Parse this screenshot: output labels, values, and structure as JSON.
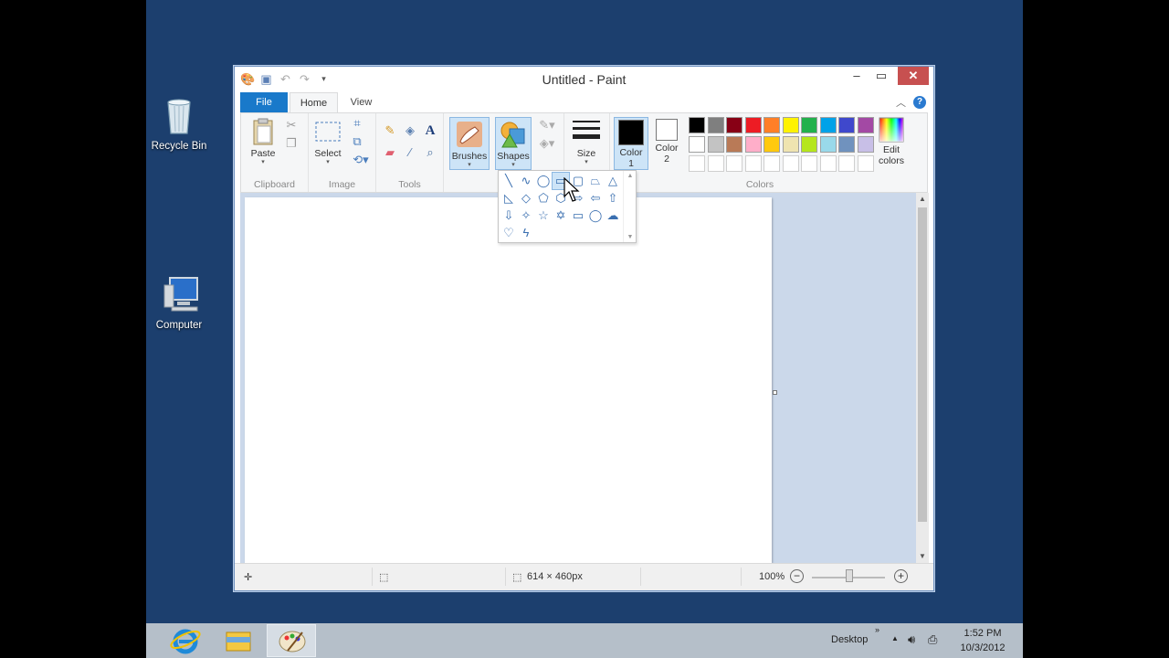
{
  "desktop": {
    "icons": [
      {
        "label": "Recycle Bin"
      },
      {
        "label": "Computer"
      }
    ]
  },
  "window": {
    "title": "Untitled - Paint",
    "tabs": {
      "file": "File",
      "home": "Home",
      "view": "View"
    }
  },
  "ribbon": {
    "clipboard": {
      "paste": "Paste",
      "label": "Clipboard"
    },
    "image": {
      "select": "Select",
      "label": "Image"
    },
    "tools": {
      "label": "Tools"
    },
    "brushes": {
      "label": "Brushes"
    },
    "shapes": {
      "label": "Shapes"
    },
    "size": {
      "label": "Size"
    },
    "color1": {
      "label_top": "Color",
      "label_bottom": "1"
    },
    "color2": {
      "label_top": "Color",
      "label_bottom": "2"
    },
    "edit_colors": {
      "label_top": "Edit",
      "label_bottom": "colors"
    },
    "colors_label": "Colors",
    "palette": {
      "row1": [
        "#000000",
        "#7f7f7f",
        "#880015",
        "#ed1c24",
        "#ff7f27",
        "#fff200",
        "#22b14c",
        "#00a2e8",
        "#3f48cc",
        "#a349a4"
      ],
      "row2": [
        "#ffffff",
        "#c3c3c3",
        "#b97a57",
        "#ffaec9",
        "#ffc90e",
        "#efe4b0",
        "#b5e61d",
        "#99d9ea",
        "#7092be",
        "#c8bfe7"
      ],
      "row3": [
        "#ffffff",
        "#ffffff",
        "#ffffff",
        "#ffffff",
        "#ffffff",
        "#ffffff",
        "#ffffff",
        "#ffffff",
        "#ffffff",
        "#ffffff"
      ]
    },
    "color1_value": "#000000",
    "color2_value": "#ffffff"
  },
  "shapes_popup": {
    "items": [
      "line",
      "curve",
      "oval",
      "rectangle",
      "rounded-rectangle",
      "polygon",
      "triangle",
      "right-triangle",
      "diamond",
      "pentagon",
      "hexagon",
      "right-arrow",
      "left-arrow",
      "up-arrow",
      "down-arrow",
      "four-point-star",
      "five-point-star",
      "six-point-star",
      "rounded-callout",
      "oval-callout",
      "cloud-callout",
      "heart",
      "lightning"
    ]
  },
  "statusbar": {
    "dimensions": "614 × 460px",
    "zoom": "100%"
  },
  "taskbar": {
    "desktop_label": "Desktop",
    "time": "1:52 PM",
    "date": "10/3/2012"
  }
}
